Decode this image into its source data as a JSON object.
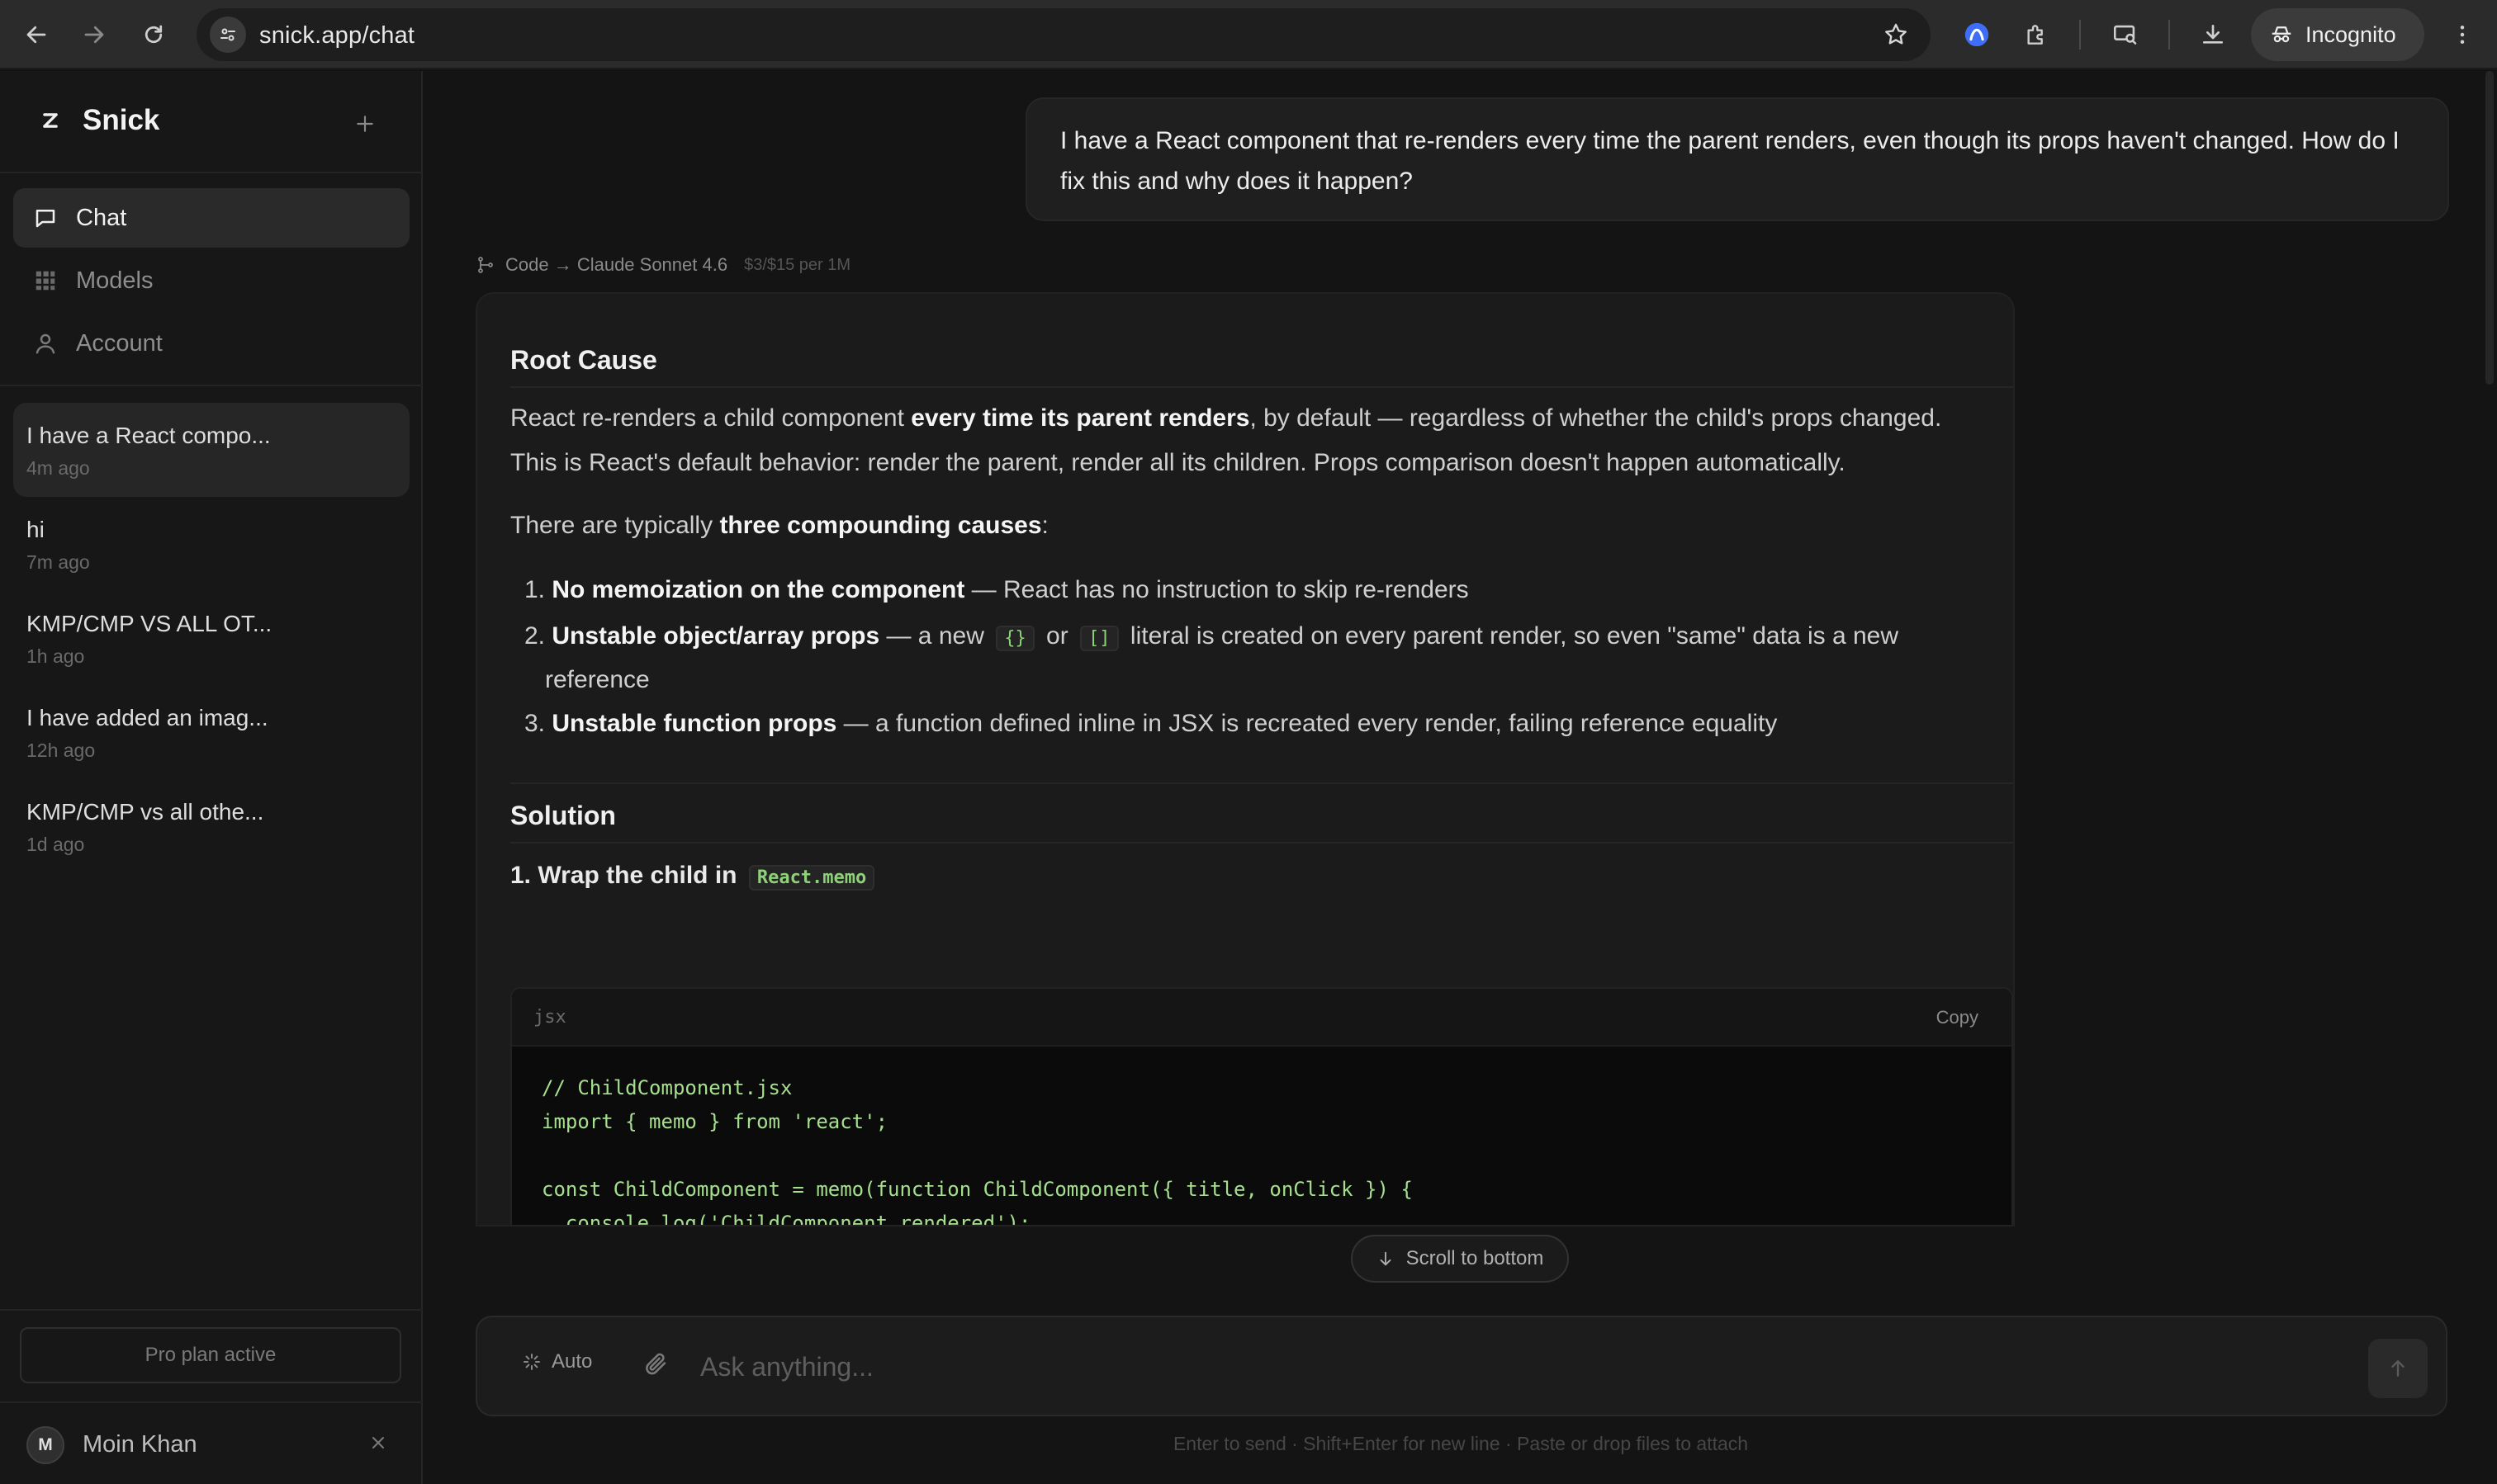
{
  "browser": {
    "url": "snick.app/chat",
    "incognito_label": "Incognito"
  },
  "sidebar": {
    "brand": "Snick",
    "nav": [
      {
        "label": "Chat",
        "icon": "chat-bubble-icon",
        "active": true
      },
      {
        "label": "Models",
        "icon": "grid-icon",
        "active": false
      },
      {
        "label": "Account",
        "icon": "person-icon",
        "active": false
      }
    ],
    "conversations": [
      {
        "title": "I have a React compo...",
        "time": "4m ago",
        "active": true
      },
      {
        "title": "hi",
        "time": "7m ago",
        "active": false
      },
      {
        "title": "KMP/CMP VS ALL OT...",
        "time": "1h ago",
        "active": false
      },
      {
        "title": "I have added an imag...",
        "time": "12h ago",
        "active": false
      },
      {
        "title": "KMP/CMP vs all othe...",
        "time": "1d ago",
        "active": false
      }
    ],
    "plan": "Pro plan active",
    "user": {
      "initial": "M",
      "name": "Moin Khan"
    }
  },
  "chat": {
    "user_message": "I have a React component that re-renders every time the parent renders, even though its props haven't changed. How do I fix this and why does it happen?",
    "meta": {
      "route": "Code → Claude Sonnet 4.6",
      "price": "$3/$15 per 1M"
    },
    "answer": {
      "h_root": "Root Cause",
      "p1_a": "React re-renders a child component ",
      "p1_b": "every time its parent renders",
      "p1_c": ", by default — regardless of whether the child's props changed.",
      "p2": "This is React's default behavior: render the parent, render all its children. Props comparison doesn't happen automatically.",
      "p3_a": "There are typically ",
      "p3_b": "three compounding causes",
      "p3_c": ":",
      "list": [
        {
          "num": "1.",
          "bold": "No memoization on the component",
          "rest": " — React has no instruction to skip re-renders"
        },
        {
          "num": "2.",
          "bold": "Unstable object/array props",
          "rest_a": " — a new ",
          "code1": "{}",
          "mid": " or ",
          "code2": "[]",
          "rest_b": " literal is created on every parent render, so even \"same\" data is a new",
          "rest_c": "reference"
        },
        {
          "num": "3.",
          "bold": "Unstable function props",
          "rest": " — a function defined inline in JSX is recreated every render, failing reference equality"
        }
      ],
      "h_solution": "Solution",
      "step1_label": "1. Wrap the child in ",
      "step1_code": "React.memo",
      "code_lang": "jsx",
      "code_copy": "Copy",
      "code": "// ChildComponent.jsx\nimport { memo } from 'react';\n\nconst ChildComponent = memo(function ChildComponent({ title, onClick }) {\n  console.log('ChildComponent rendered');\n  return <button onClick={onClick}>{title}</button>;\n});"
    },
    "scroll_label": "Scroll to bottom",
    "composer": {
      "mode": "Auto",
      "placeholder": "Ask anything...",
      "hint": "Enter to send · Shift+Enter for new line · Paste or drop files to attach"
    }
  }
}
